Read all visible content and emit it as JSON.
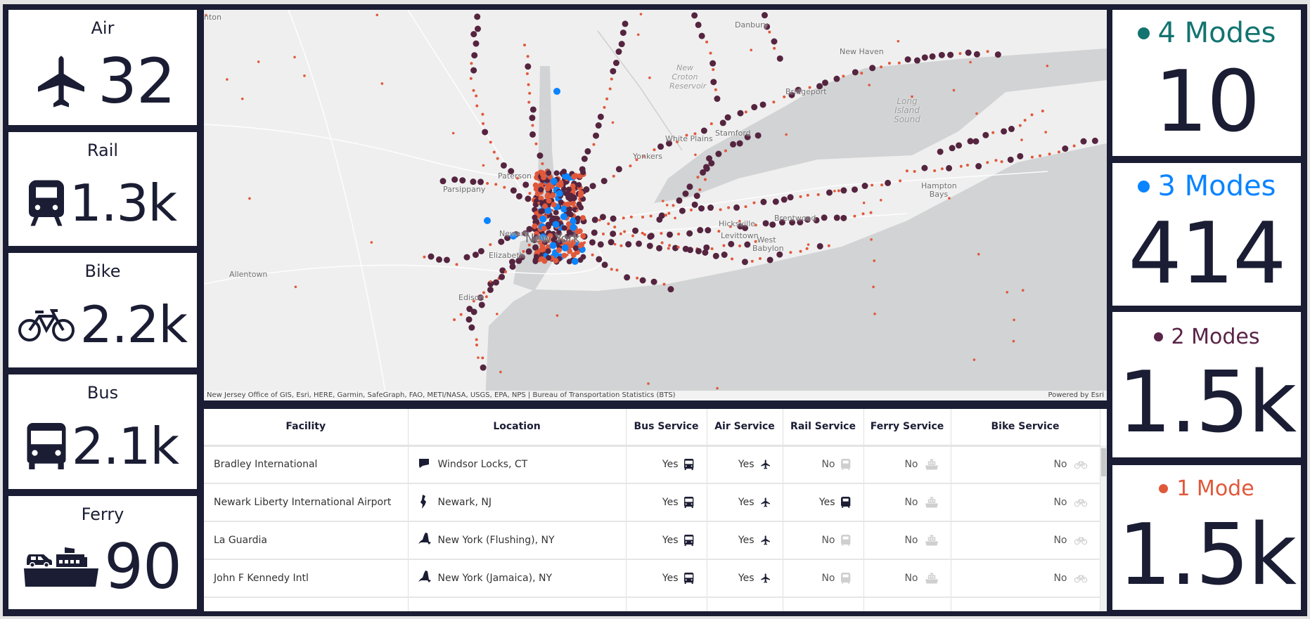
{
  "mode_counts": [
    {
      "label": "Air",
      "value": "32",
      "icon": "airplane-icon"
    },
    {
      "label": "Rail",
      "value": "1.3k",
      "icon": "train-icon"
    },
    {
      "label": "Bike",
      "value": "2.2k",
      "icon": "bicycle-icon"
    },
    {
      "label": "Bus",
      "value": "2.1k",
      "icon": "bus-icon"
    },
    {
      "label": "Ferry",
      "value": "90",
      "icon": "ferry-icon"
    }
  ],
  "modes_summary": [
    {
      "label": "4 Modes",
      "value": "10",
      "color": "#127470"
    },
    {
      "label": "3 Modes",
      "value": "414",
      "color": "#0a84ff"
    },
    {
      "label": "2 Modes",
      "value": "1.5k",
      "color": "#5a2448"
    },
    {
      "label": "1 Mode",
      "value": "1.5k",
      "color": "#e0583a"
    }
  ],
  "map": {
    "labels": [
      "Allentown",
      "Paterson",
      "Parsippany",
      "Newark",
      "Elizabeth",
      "Edison",
      "New York",
      "Yonkers",
      "Danbury",
      "New Haven",
      "Bridgeport",
      "Stamford",
      "White Plains",
      "Hicksville",
      "Levittown",
      "Brentwood",
      "nton"
    ],
    "water_labels": [
      "New Croton Reservoir",
      "Long Island Sound",
      "West Babylon",
      "Hampton Bays"
    ],
    "attribution": "New Jersey Office of GIS, Esri, HERE, Garmin, SafeGraph, FAO, METI/NASA, USGS, EPA, NPS | Bureau of Transportation Statistics (BTS)",
    "powered_by": "Powered by Esri",
    "colors": {
      "land": "#efefef",
      "water": "#d1d3d4",
      "one": "#e0583a",
      "two": "#55243f",
      "three": "#0a84ff"
    }
  },
  "table": {
    "columns": [
      "Facility",
      "Location",
      "Bus Service",
      "Air Service",
      "Rail Service",
      "Ferry Service",
      "Bike Service"
    ],
    "rows": [
      {
        "facility": "Bradley International",
        "location": "Windsor Locks, CT",
        "state": "CT",
        "bus": "Yes",
        "air": "Yes",
        "rail": "No",
        "ferry": "No",
        "bike": "No"
      },
      {
        "facility": "Newark Liberty International Airport",
        "location": "Newark, NJ",
        "state": "NJ",
        "bus": "Yes",
        "air": "Yes",
        "rail": "Yes",
        "ferry": "No",
        "bike": "No"
      },
      {
        "facility": "La Guardia",
        "location": "New York (Flushing), NY",
        "state": "NY",
        "bus": "Yes",
        "air": "Yes",
        "rail": "No",
        "ferry": "No",
        "bike": "No"
      },
      {
        "facility": "John F Kennedy Intl",
        "location": "New York (Jamaica), NY",
        "state": "NY",
        "bus": "Yes",
        "air": "Yes",
        "rail": "No",
        "ferry": "No",
        "bike": "No"
      }
    ]
  }
}
